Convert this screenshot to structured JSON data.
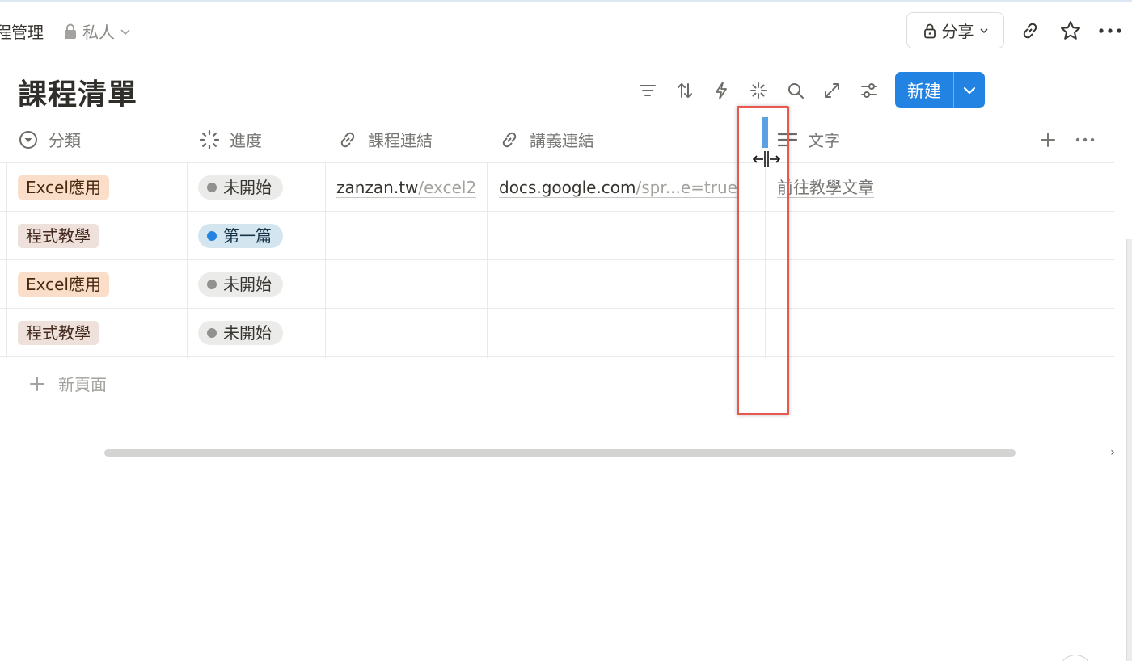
{
  "topbar": {
    "breadcrumb": "程管理",
    "privacy_label": "私人",
    "share_label": "分享"
  },
  "page": {
    "title": "課程清單",
    "new_button_label": "新建"
  },
  "table": {
    "columns": [
      {
        "label": "分類",
        "icon": "select-icon"
      },
      {
        "label": "進度",
        "icon": "status-icon"
      },
      {
        "label": "課程連結",
        "icon": "link-icon"
      },
      {
        "label": "講義連結",
        "icon": "link-icon"
      },
      {
        "label": "文字",
        "icon": "text-icon"
      }
    ],
    "rows": [
      {
        "category": "Excel應用",
        "status": "未開始",
        "course_host": "zanzan.tw",
        "course_path": "/excel2",
        "handout_host": "docs.google.com",
        "handout_path": "/spr...e=true",
        "text": "前往教學文章"
      },
      {
        "category": "程式教學",
        "status": "第一篇"
      },
      {
        "category": "Excel應用",
        "status": "未開始"
      },
      {
        "category": "程式教學",
        "status": "未開始"
      }
    ],
    "new_page_label": "新頁面"
  },
  "colors": {
    "accent": "#2383e2",
    "highlight": "#e8584f"
  }
}
